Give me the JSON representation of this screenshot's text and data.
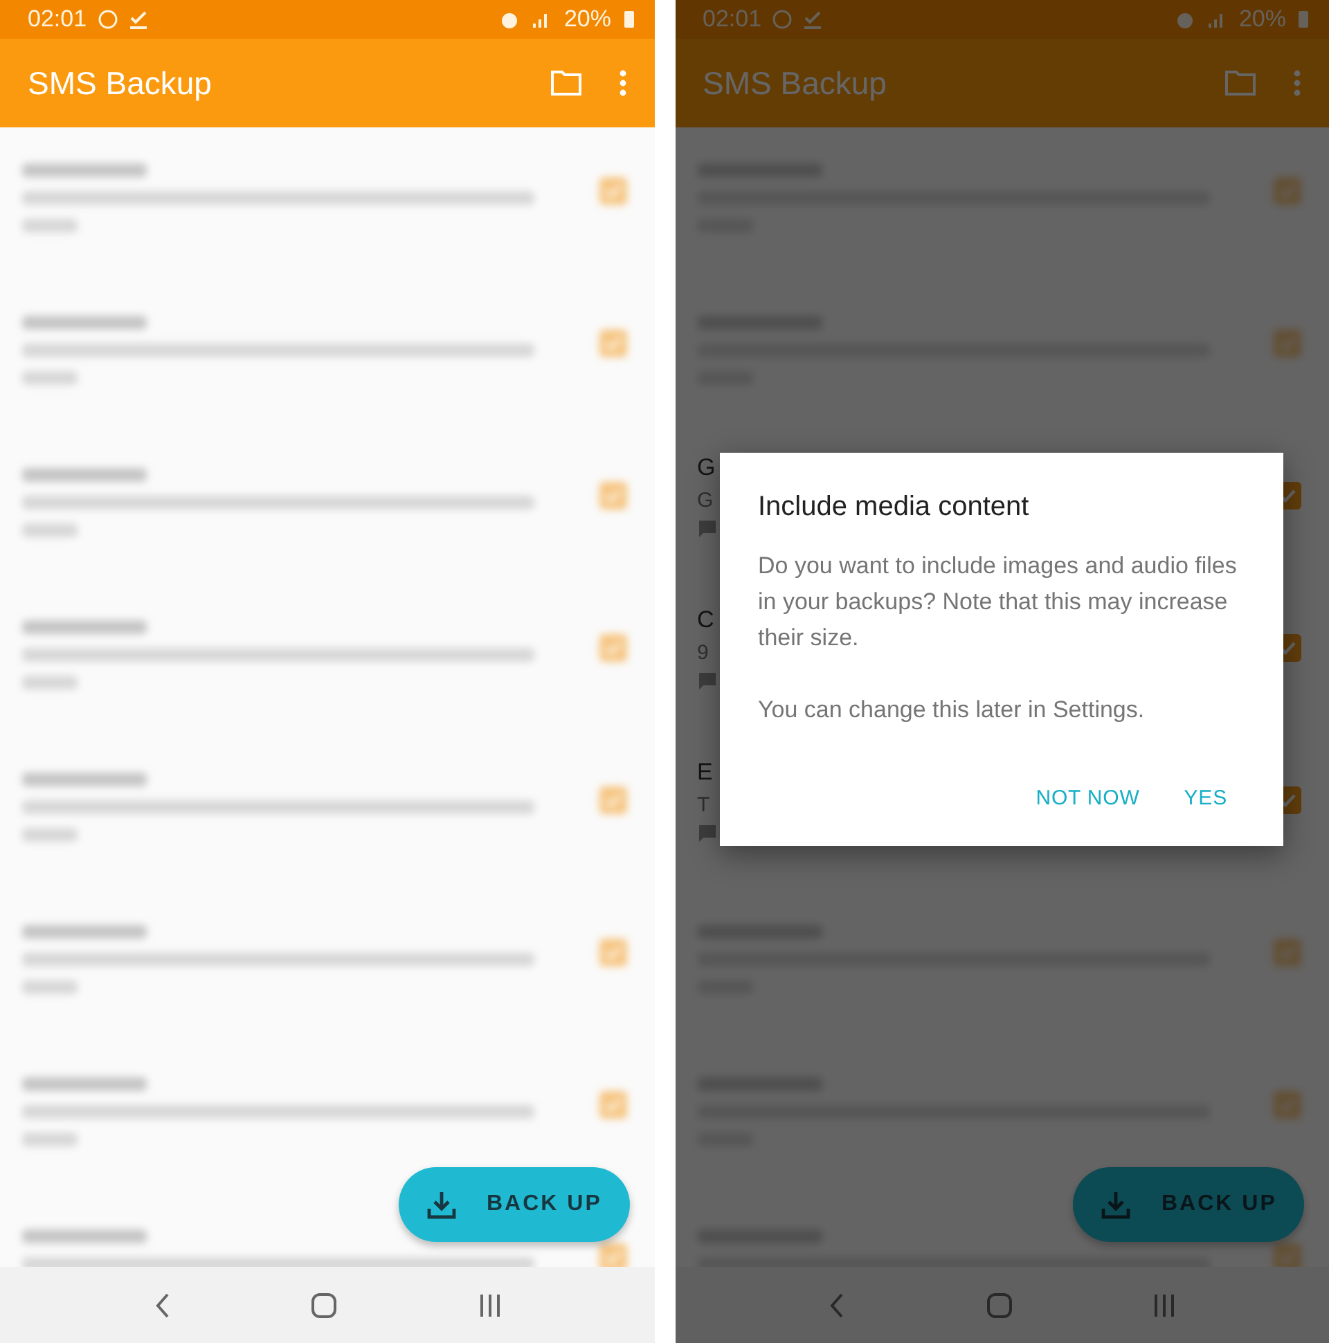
{
  "screens": [
    {
      "status_bar": {
        "time": "02:01",
        "battery": "20%"
      },
      "app_bar": {
        "title": "SMS Backup"
      },
      "conversations": [
        {
          "kind": "blurred",
          "checked": true
        },
        {
          "kind": "blurred",
          "checked": true
        },
        {
          "kind": "blurred",
          "checked": true
        },
        {
          "kind": "blurred",
          "checked": true
        },
        {
          "kind": "blurred",
          "checked": true
        },
        {
          "kind": "blurred",
          "checked": true
        },
        {
          "kind": "blurred",
          "checked": true
        },
        {
          "kind": "blurred",
          "checked": true
        }
      ],
      "fab": {
        "label": "BACK UP"
      }
    },
    {
      "status_bar": {
        "time": "02:01",
        "battery": "20%"
      },
      "app_bar": {
        "title": "SMS Backup"
      },
      "conversations": [
        {
          "kind": "blurred",
          "checked": true
        },
        {
          "kind": "blurred",
          "checked": true
        },
        {
          "kind": "partial",
          "checked": true,
          "title": "G",
          "snippet": "G"
        },
        {
          "kind": "partial",
          "checked": true,
          "title": "C",
          "snippet": "9"
        },
        {
          "kind": "partial",
          "checked": true,
          "title": "E",
          "snippet": "T"
        },
        {
          "kind": "blurred",
          "checked": true
        },
        {
          "kind": "blurred",
          "checked": true
        },
        {
          "kind": "blurred",
          "checked": true
        }
      ],
      "fab": {
        "label": "BACK UP"
      },
      "dialog": {
        "title": "Include media content",
        "message": "Do you want to include images and audio files in your backups? Note that this may increase their size.",
        "note": "You can change this later in Settings.",
        "buttons": [
          {
            "label": "NOT NOW"
          },
          {
            "label": "YES"
          }
        ]
      }
    }
  ]
}
